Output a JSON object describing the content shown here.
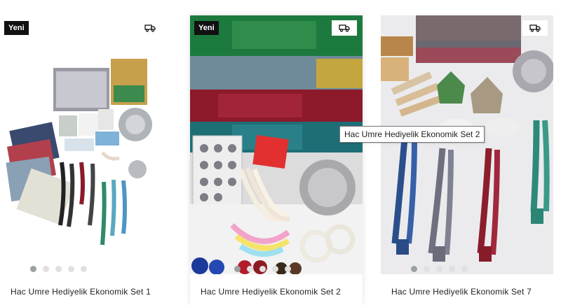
{
  "products": [
    {
      "badge": "Yeni",
      "title": "Hac Umre Hediyelik Ekonomik Set 1",
      "shipping_icon": "truck-icon",
      "dots_total": 5,
      "dot_active_index": 0
    },
    {
      "badge": "Yeni",
      "title": "Hac Umre Hediyelik Ekonomik Set 2",
      "shipping_icon": "truck-icon",
      "dots_total": 5,
      "dot_active_index": 0
    },
    {
      "badge": "",
      "title": "Hac Umre Hediyelik Ekonomik Set 7",
      "shipping_icon": "truck-icon",
      "dots_total": 5,
      "dot_active_index": 0
    }
  ],
  "tooltip": {
    "text": "Hac Umre Hediyelik Ekonomik Set 2"
  },
  "colors": {
    "badge_bg": "#111111",
    "dot_active": "#9aa0a0",
    "dot_inactive": "#e0e0e0"
  }
}
